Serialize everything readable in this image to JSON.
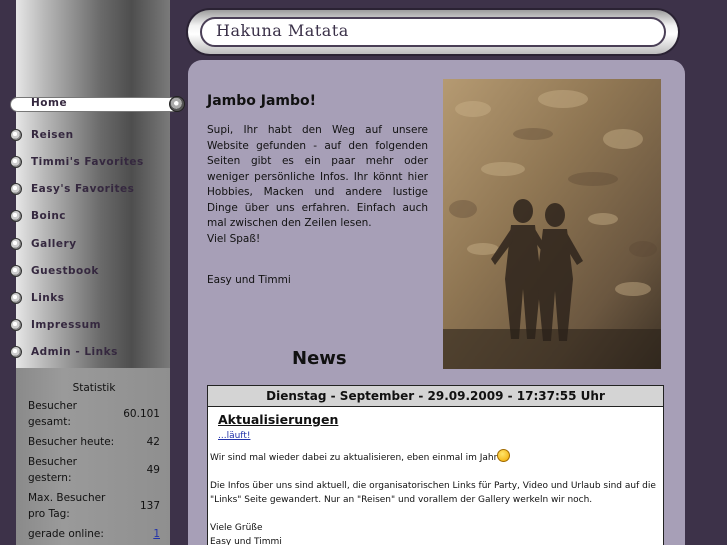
{
  "site": {
    "title": "Hakuna Matata"
  },
  "nav": {
    "items": [
      {
        "label": "Home",
        "active": true
      },
      {
        "label": "Reisen"
      },
      {
        "label": "Timmi's Favorites"
      },
      {
        "label": "Easy's Favorites"
      },
      {
        "label": "Boinc"
      },
      {
        "label": "Gallery"
      },
      {
        "label": "Guestbook"
      },
      {
        "label": "Links"
      },
      {
        "label": "Impressum"
      },
      {
        "label": "Admin - Links"
      }
    ]
  },
  "stats": {
    "title": "Statistik",
    "rows": [
      {
        "label": "Besucher gesamt:",
        "value": "60.101"
      },
      {
        "label": "Besucher heute:",
        "value": "42"
      },
      {
        "label": "Besucher gestern:",
        "value": "49"
      },
      {
        "label": "Max. Besucher pro Tag:",
        "value": "137"
      },
      {
        "label": "gerade online:",
        "value": "1"
      }
    ]
  },
  "welcome": {
    "title": "Jambo Jambo!",
    "text": "Supi, Ihr habt den Weg auf unsere Website gefunden - auf den folgenden Seiten gibt es ein paar mehr oder weniger persönliche Infos. Ihr könnt hier Hobbies, Macken und andere lustige Dinge über uns erfahren. Einfach auch mal zwischen den Zeilen lesen.",
    "closing": "Viel Spaß!",
    "signature": "Easy und Timmi"
  },
  "news": {
    "title": "News",
    "date": "Dienstag - September - 29.09.2009 - 17:37:55 Uhr",
    "headline": "Aktualisierungen",
    "sub": "...läuft!",
    "line1": "Wir sind mal wieder dabei zu aktualisieren, eben einmal im Jahr",
    "line2": "Die Infos über uns sind aktuell, die organisatorischen Links für Party, Video und Urlaub sind auf die \"Links\" Seite gewandert. Nur an \"Reisen\" und vorallem der Gallery werkeln wir noch.",
    "greeting": "Viele Grüße",
    "signature": "Easy und Timmi"
  }
}
